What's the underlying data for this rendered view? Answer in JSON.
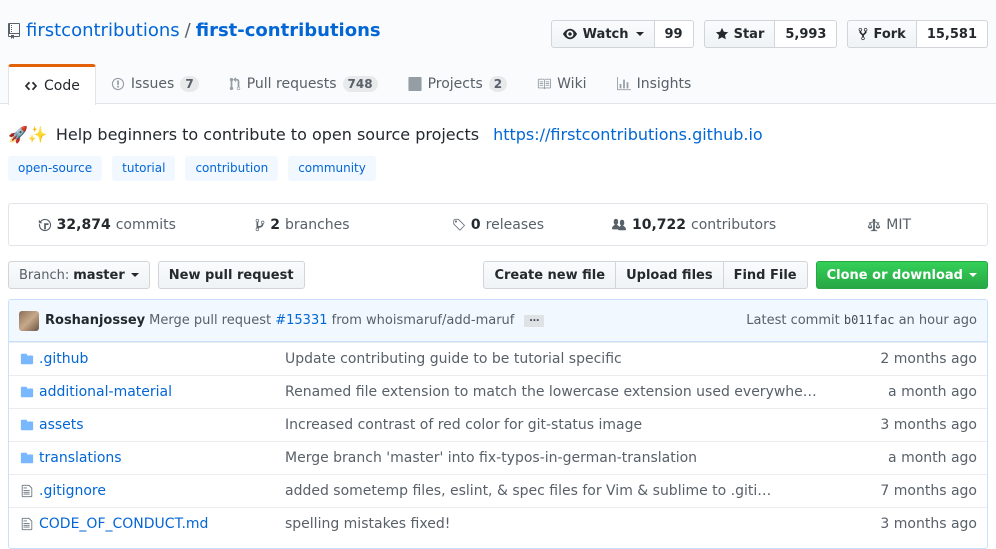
{
  "repo": {
    "owner": "firstcontributions",
    "separator": "/",
    "name": "first-contributions"
  },
  "actions": {
    "watch": {
      "label": "Watch",
      "count": "99"
    },
    "star": {
      "label": "Star",
      "count": "5,993"
    },
    "fork": {
      "label": "Fork",
      "count": "15,581"
    }
  },
  "tabs": [
    {
      "label": "Code",
      "icon": "code-icon"
    },
    {
      "label": "Issues",
      "count": "7",
      "icon": "issue-icon"
    },
    {
      "label": "Pull requests",
      "count": "748",
      "icon": "pull-request-icon"
    },
    {
      "label": "Projects",
      "count": "2",
      "icon": "project-icon"
    },
    {
      "label": "Wiki",
      "icon": "book-icon"
    },
    {
      "label": "Insights",
      "icon": "graph-icon"
    }
  ],
  "description": {
    "emoji": "🚀✨",
    "text": "Help beginners to contribute to open source projects",
    "link": "https://firstcontributions.github.io"
  },
  "topics": [
    "open-source",
    "tutorial",
    "contribution",
    "community"
  ],
  "numbers": {
    "commits": {
      "value": "32,874",
      "label": "commits"
    },
    "branches": {
      "value": "2",
      "label": "branches"
    },
    "releases": {
      "value": "0",
      "label": "releases"
    },
    "contributors": {
      "value": "10,722",
      "label": "contributors"
    },
    "license": "MIT"
  },
  "file_nav": {
    "branch_prefix": "Branch:",
    "branch": "master",
    "new_pr": "New pull request",
    "create_file": "Create new file",
    "upload_files": "Upload files",
    "find_file": "Find File",
    "clone": "Clone or download"
  },
  "commit": {
    "author": "Roshanjossey",
    "message": "Merge pull request",
    "pr": "#15331",
    "from": "from whoismaruf/add-maruf",
    "ellipsis": "…",
    "latest_label": "Latest commit",
    "sha": "b011fac",
    "age": "an hour ago"
  },
  "files": [
    {
      "type": "dir",
      "name": ".github",
      "message": "Update contributing guide to be tutorial specific",
      "age": "2 months ago"
    },
    {
      "type": "dir",
      "name": "additional-material",
      "message": "Renamed file extension to match the lowercase extension used everywhe…",
      "age": "a month ago"
    },
    {
      "type": "dir",
      "name": "assets",
      "message": "Increased contrast of red color for git-status image",
      "age": "3 months ago"
    },
    {
      "type": "dir",
      "name": "translations",
      "message": "Merge branch 'master' into fix-typos-in-german-translation",
      "age": "a month ago"
    },
    {
      "type": "file",
      "name": ".gitignore",
      "message": "added sometemp files, eslint, & spec files for Vim & sublime to .giti…",
      "age": "7 months ago"
    },
    {
      "type": "file",
      "name": "CODE_OF_CONDUCT.md",
      "message": "spelling mistakes fixed!",
      "age": "3 months ago"
    }
  ]
}
